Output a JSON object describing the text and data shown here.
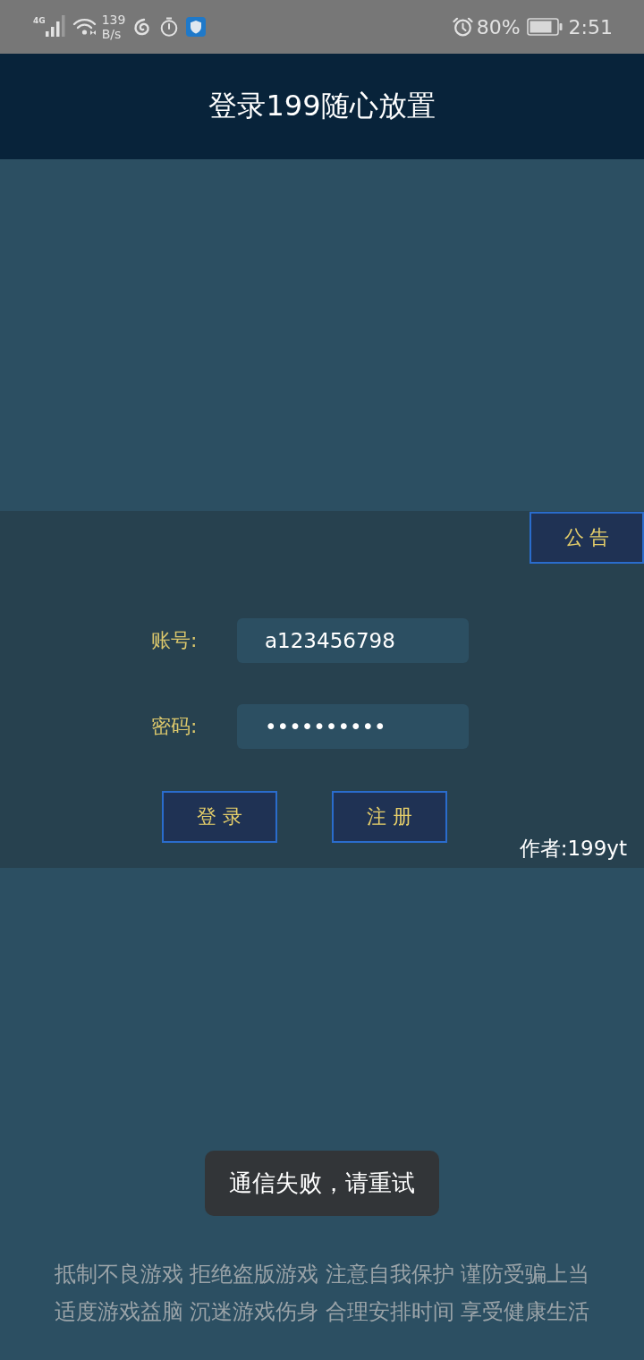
{
  "status_bar": {
    "network_type": "4G",
    "speed_value": "139",
    "speed_unit": "B/s",
    "battery": "80%",
    "time": "2:51"
  },
  "header": {
    "title": "登录199随心放置"
  },
  "panel": {
    "notice_button": "公 告",
    "fields": [
      {
        "label": "账号:",
        "value": "a123456798"
      },
      {
        "label": "密码:",
        "value": "••••••••••"
      }
    ],
    "buttons": [
      "登 录",
      "注 册"
    ],
    "author": "作者:199yt"
  },
  "toast": "通信失败，请重试",
  "footer_lines": [
    "抵制不良游戏 拒绝盗版游戏 注意自我保护 谨防受骗上当",
    "适度游戏益脑 沉迷游戏伤身 合理安排时间 享受健康生活"
  ]
}
